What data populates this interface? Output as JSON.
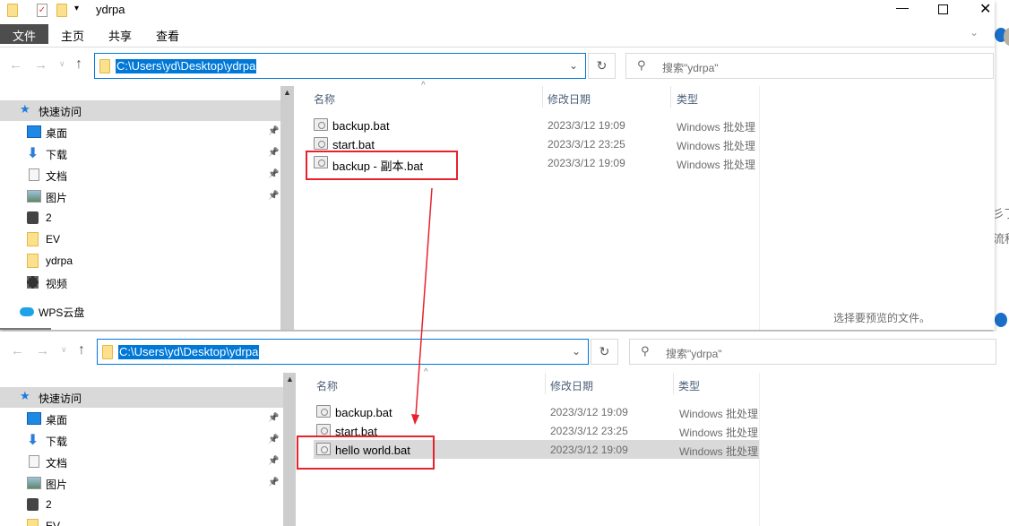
{
  "top_window": {
    "title": "ydrpa",
    "ribbon_tabs": [
      "文件",
      "主页",
      "共享",
      "查看"
    ],
    "address": "C:\\Users\\yd\\Desktop\\ydrpa",
    "search_placeholder": "搜索\"ydrpa\"",
    "nav_items": [
      {
        "label": "快速访问",
        "icon": "star-icon"
      },
      {
        "label": "桌面",
        "icon": "desktop-icon",
        "pinned": true
      },
      {
        "label": "下载",
        "icon": "download-icon",
        "pinned": true
      },
      {
        "label": "文档",
        "icon": "document-icon",
        "pinned": true
      },
      {
        "label": "图片",
        "icon": "picture-icon",
        "pinned": true
      },
      {
        "label": "2",
        "icon": "computer-icon"
      },
      {
        "label": "EV",
        "icon": "folder-icon"
      },
      {
        "label": "ydrpa",
        "icon": "folder-icon"
      },
      {
        "label": "视频",
        "icon": "video-icon"
      },
      {
        "label": "WPS云盘",
        "icon": "cloud-icon"
      }
    ],
    "columns": [
      "名称",
      "修改日期",
      "类型"
    ],
    "files": [
      {
        "name": "backup.bat",
        "date": "2023/3/12 19:09",
        "type": "Windows 批处理"
      },
      {
        "name": "start.bat",
        "date": "2023/3/12 23:25",
        "type": "Windows 批处理"
      },
      {
        "name": "backup - 副本.bat",
        "date": "2023/3/12 19:09",
        "type": "Windows 批处理"
      }
    ],
    "preview_text": "选择要预览的文件。"
  },
  "bottom_window": {
    "address": "C:\\Users\\yd\\Desktop\\ydrpa",
    "search_placeholder": "搜索\"ydrpa\"",
    "nav_items": [
      {
        "label": "快速访问"
      },
      {
        "label": "桌面"
      },
      {
        "label": "下载"
      },
      {
        "label": "文档"
      },
      {
        "label": "图片"
      },
      {
        "label": "2"
      },
      {
        "label": "EV"
      }
    ],
    "columns": [
      "名称",
      "修改日期",
      "类型"
    ],
    "files": [
      {
        "name": "backup.bat",
        "date": "2023/3/12 19:09",
        "type": "Windows 批处理"
      },
      {
        "name": "start.bat",
        "date": "2023/3/12 23:25",
        "type": "Windows 批处理"
      },
      {
        "name": "hello world.bat",
        "date": "2023/3/12 19:09",
        "type": "Windows 批处理"
      }
    ]
  },
  "background_window": {
    "text1": "彡丁",
    "text2": "流程"
  },
  "colors": {
    "accent": "#0078d7",
    "annotation": "#e8222d",
    "selected": "#d9d9d9"
  }
}
